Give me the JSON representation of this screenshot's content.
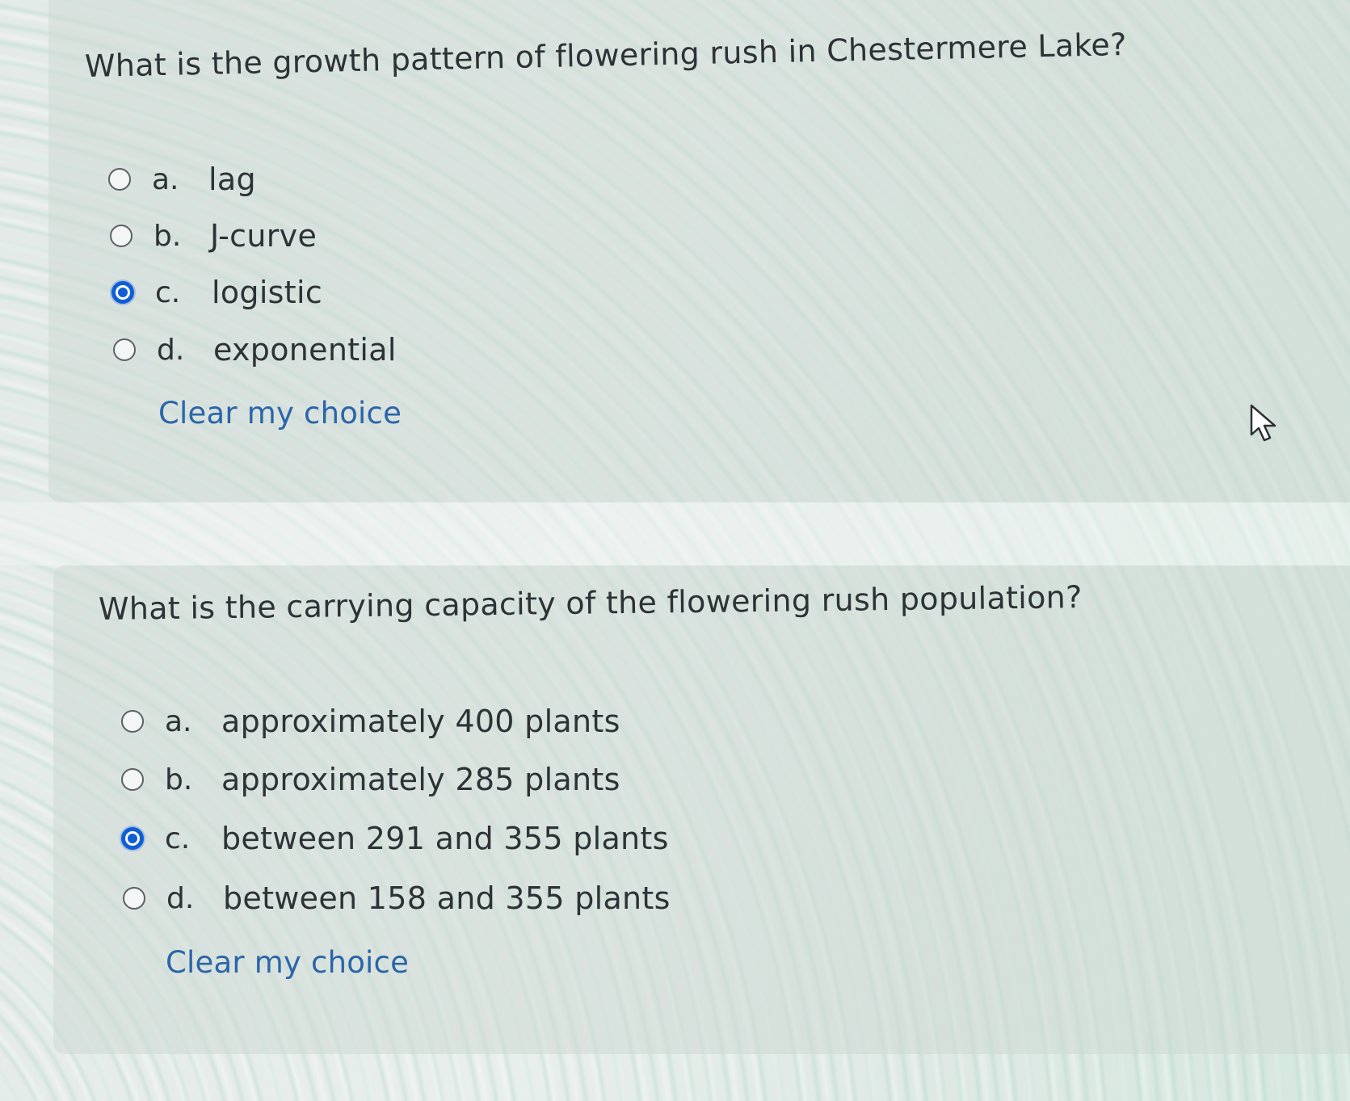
{
  "questions": [
    {
      "text": "What is the growth pattern of flowering rush in Chestermere Lake?",
      "options": [
        {
          "letter": "a.",
          "text": "lag",
          "selected": false
        },
        {
          "letter": "b.",
          "text": "J-curve",
          "selected": false
        },
        {
          "letter": "c.",
          "text": "logistic",
          "selected": true
        },
        {
          "letter": "d.",
          "text": "exponential",
          "selected": false
        }
      ],
      "clear_label": "Clear my choice"
    },
    {
      "text": "What is the carrying capacity of the flowering rush population?",
      "options": [
        {
          "letter": "a.",
          "text": "approximately 400 plants",
          "selected": false
        },
        {
          "letter": "b.",
          "text": "approximately 285 plants",
          "selected": false
        },
        {
          "letter": "c.",
          "text": "between 291 and 355 plants",
          "selected": true
        },
        {
          "letter": "d.",
          "text": "between 158 and 355 plants",
          "selected": false
        }
      ],
      "clear_label": "Clear my choice"
    }
  ],
  "colors": {
    "accent": "#0f5ed6",
    "link": "#2a65a8",
    "card": "#cdd8d4"
  },
  "icons": {
    "cursor": "mouse-pointer-icon"
  }
}
